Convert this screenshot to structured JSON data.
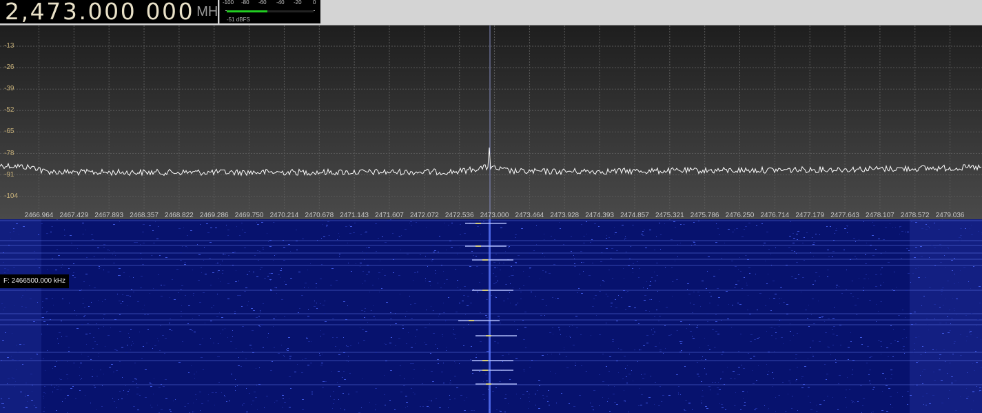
{
  "header": {
    "frequency": "2,473.000 000",
    "unit": "MHz"
  },
  "meter": {
    "scale_labels": [
      "-100",
      "-80",
      "-60",
      "-40",
      "-20",
      "0"
    ],
    "readout": "-51 dBFS",
    "level_dbfs": -51,
    "range_dbfs": [
      -100,
      0
    ],
    "bar_color": "#22cc22"
  },
  "spectrum": {
    "db_labels": [
      "-13",
      "-26",
      "-39",
      "-52",
      "-65",
      "-78",
      "-91",
      "-104"
    ],
    "freq_labels": [
      "2466.964",
      "2467.429",
      "2467.893",
      "2468.357",
      "2468.822",
      "2469.286",
      "2469.750",
      "2470.214",
      "2470.678",
      "2471.143",
      "2471.607",
      "2472.072",
      "2472.536",
      "2473.000",
      "2473.464",
      "2473.928",
      "2474.393",
      "2474.857",
      "2475.321",
      "2475.786",
      "2476.250",
      "2476.714",
      "2477.179",
      "2477.643",
      "2478.107",
      "2478.572",
      "2479.036"
    ],
    "center_line_color": "#8890c8",
    "trace_color": "#ffffff",
    "label_color": "#c9b27a"
  },
  "waterfall": {
    "background_color": "#07126e",
    "tooltip": "F: 2466500.000 kHz"
  }
}
